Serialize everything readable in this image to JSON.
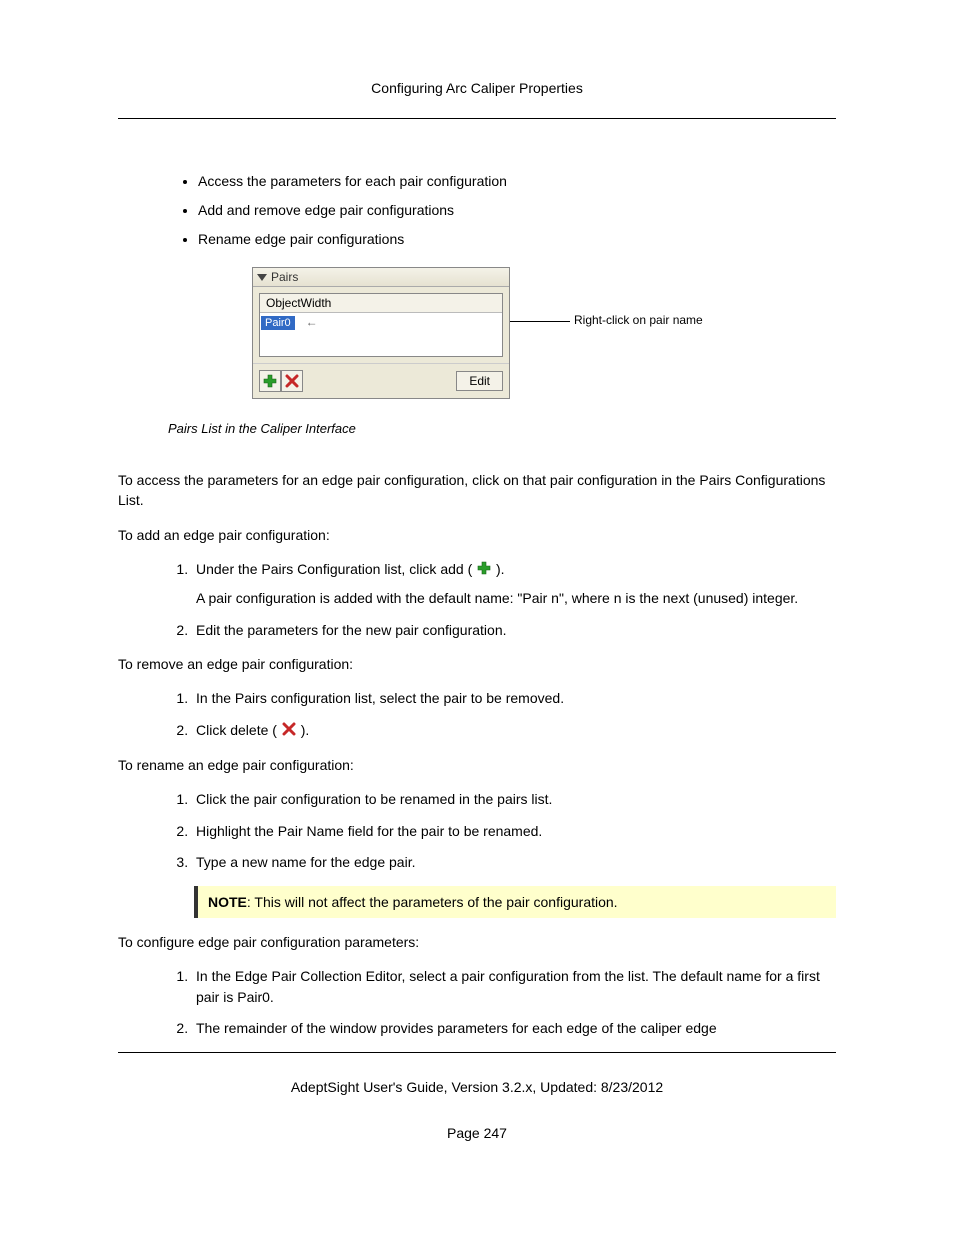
{
  "header": "Configuring Arc Caliper Properties",
  "bullets": [
    "Access the parameters for each pair configuration",
    "Add and remove edge pair configurations",
    "Rename edge pair configurations"
  ],
  "figure": {
    "panel_title": "Pairs",
    "col_header": "ObjectWidth",
    "selected_item": "Pair0",
    "edit_button": "Edit",
    "callout": "Right-click on pair name"
  },
  "caption": "Pairs List in the Caliper Interface",
  "p_access": "To access the parameters for an edge pair configuration, click on that pair configuration in the Pairs Configurations List.",
  "p_add_intro": "To add an edge pair configuration:",
  "add_steps": {
    "s1_before": "Under the Pairs Configuration list, click add (",
    "s1_after": ").",
    "s1_sub": "A pair configuration is added with the default name: \"Pair n\", where n is the next (unused) integer.",
    "s2": "Edit the parameters for the new pair configuration."
  },
  "p_remove_intro": "To remove an edge pair configuration:",
  "remove_steps": {
    "s1": "In the Pairs configuration list, select the pair to be removed.",
    "s2_before": "Click delete (",
    "s2_after": ")."
  },
  "p_rename_intro": "To rename an edge pair configuration:",
  "rename_steps": {
    "s1": "Click the pair configuration to be renamed in the pairs list.",
    "s2": "Highlight the Pair Name field for the pair to be renamed.",
    "s3": "Type a new name for the edge pair."
  },
  "note_label": "NOTE",
  "note_text": ": This will not affect the parameters of the pair configuration.",
  "p_configure_intro": "To configure edge pair configuration parameters:",
  "configure_steps": {
    "s1": "In the Edge Pair Collection Editor, select a pair configuration from the list. The default name for a first pair is Pair0.",
    "s2": "The remainder of the window provides parameters for each edge of the caliper edge"
  },
  "footer": "AdeptSight User's Guide,  Version 3.2.x,  Updated: 8/23/2012",
  "page_number": "Page 247"
}
